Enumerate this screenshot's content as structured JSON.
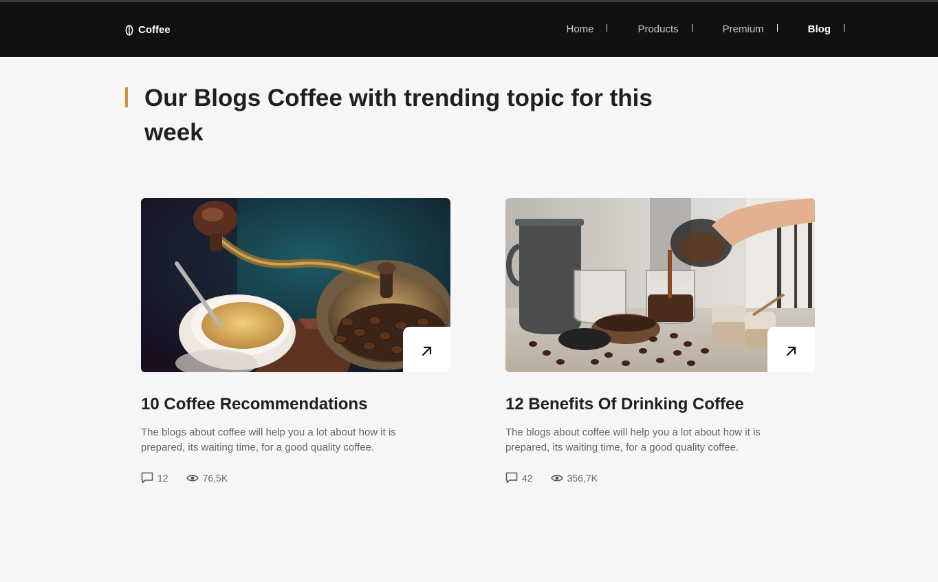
{
  "brand": {
    "name": "Coffee",
    "icon": "coffee-bean-icon"
  },
  "nav": {
    "items": [
      {
        "label": "Home"
      },
      {
        "label": "Products"
      },
      {
        "label": "Premium"
      },
      {
        "label": "Blog",
        "active": true
      }
    ]
  },
  "section": {
    "title": "Our Blogs Coffee with trending topic for this week",
    "accent_color": "#d48f3c"
  },
  "posts": [
    {
      "title": "10 Coffee Recommendations",
      "description": "The blogs about coffee will help you a lot about how it is prepared, its waiting time, for a good quality coffee.",
      "comments": "12",
      "views": "76,5K",
      "image": "coffee-grinder-photo"
    },
    {
      "title": "12 Benefits Of Drinking Coffee",
      "description": "The blogs about coffee will help you a lot about how it is prepared, its waiting time, for a good quality coffee.",
      "comments": "42",
      "views": "356,7K",
      "image": "coffee-pouring-photo"
    }
  ],
  "colors": {
    "header_bg": "#111111",
    "page_bg": "#f6f6f6",
    "text_dark": "#1f1f1f",
    "text_muted": "#666666"
  }
}
